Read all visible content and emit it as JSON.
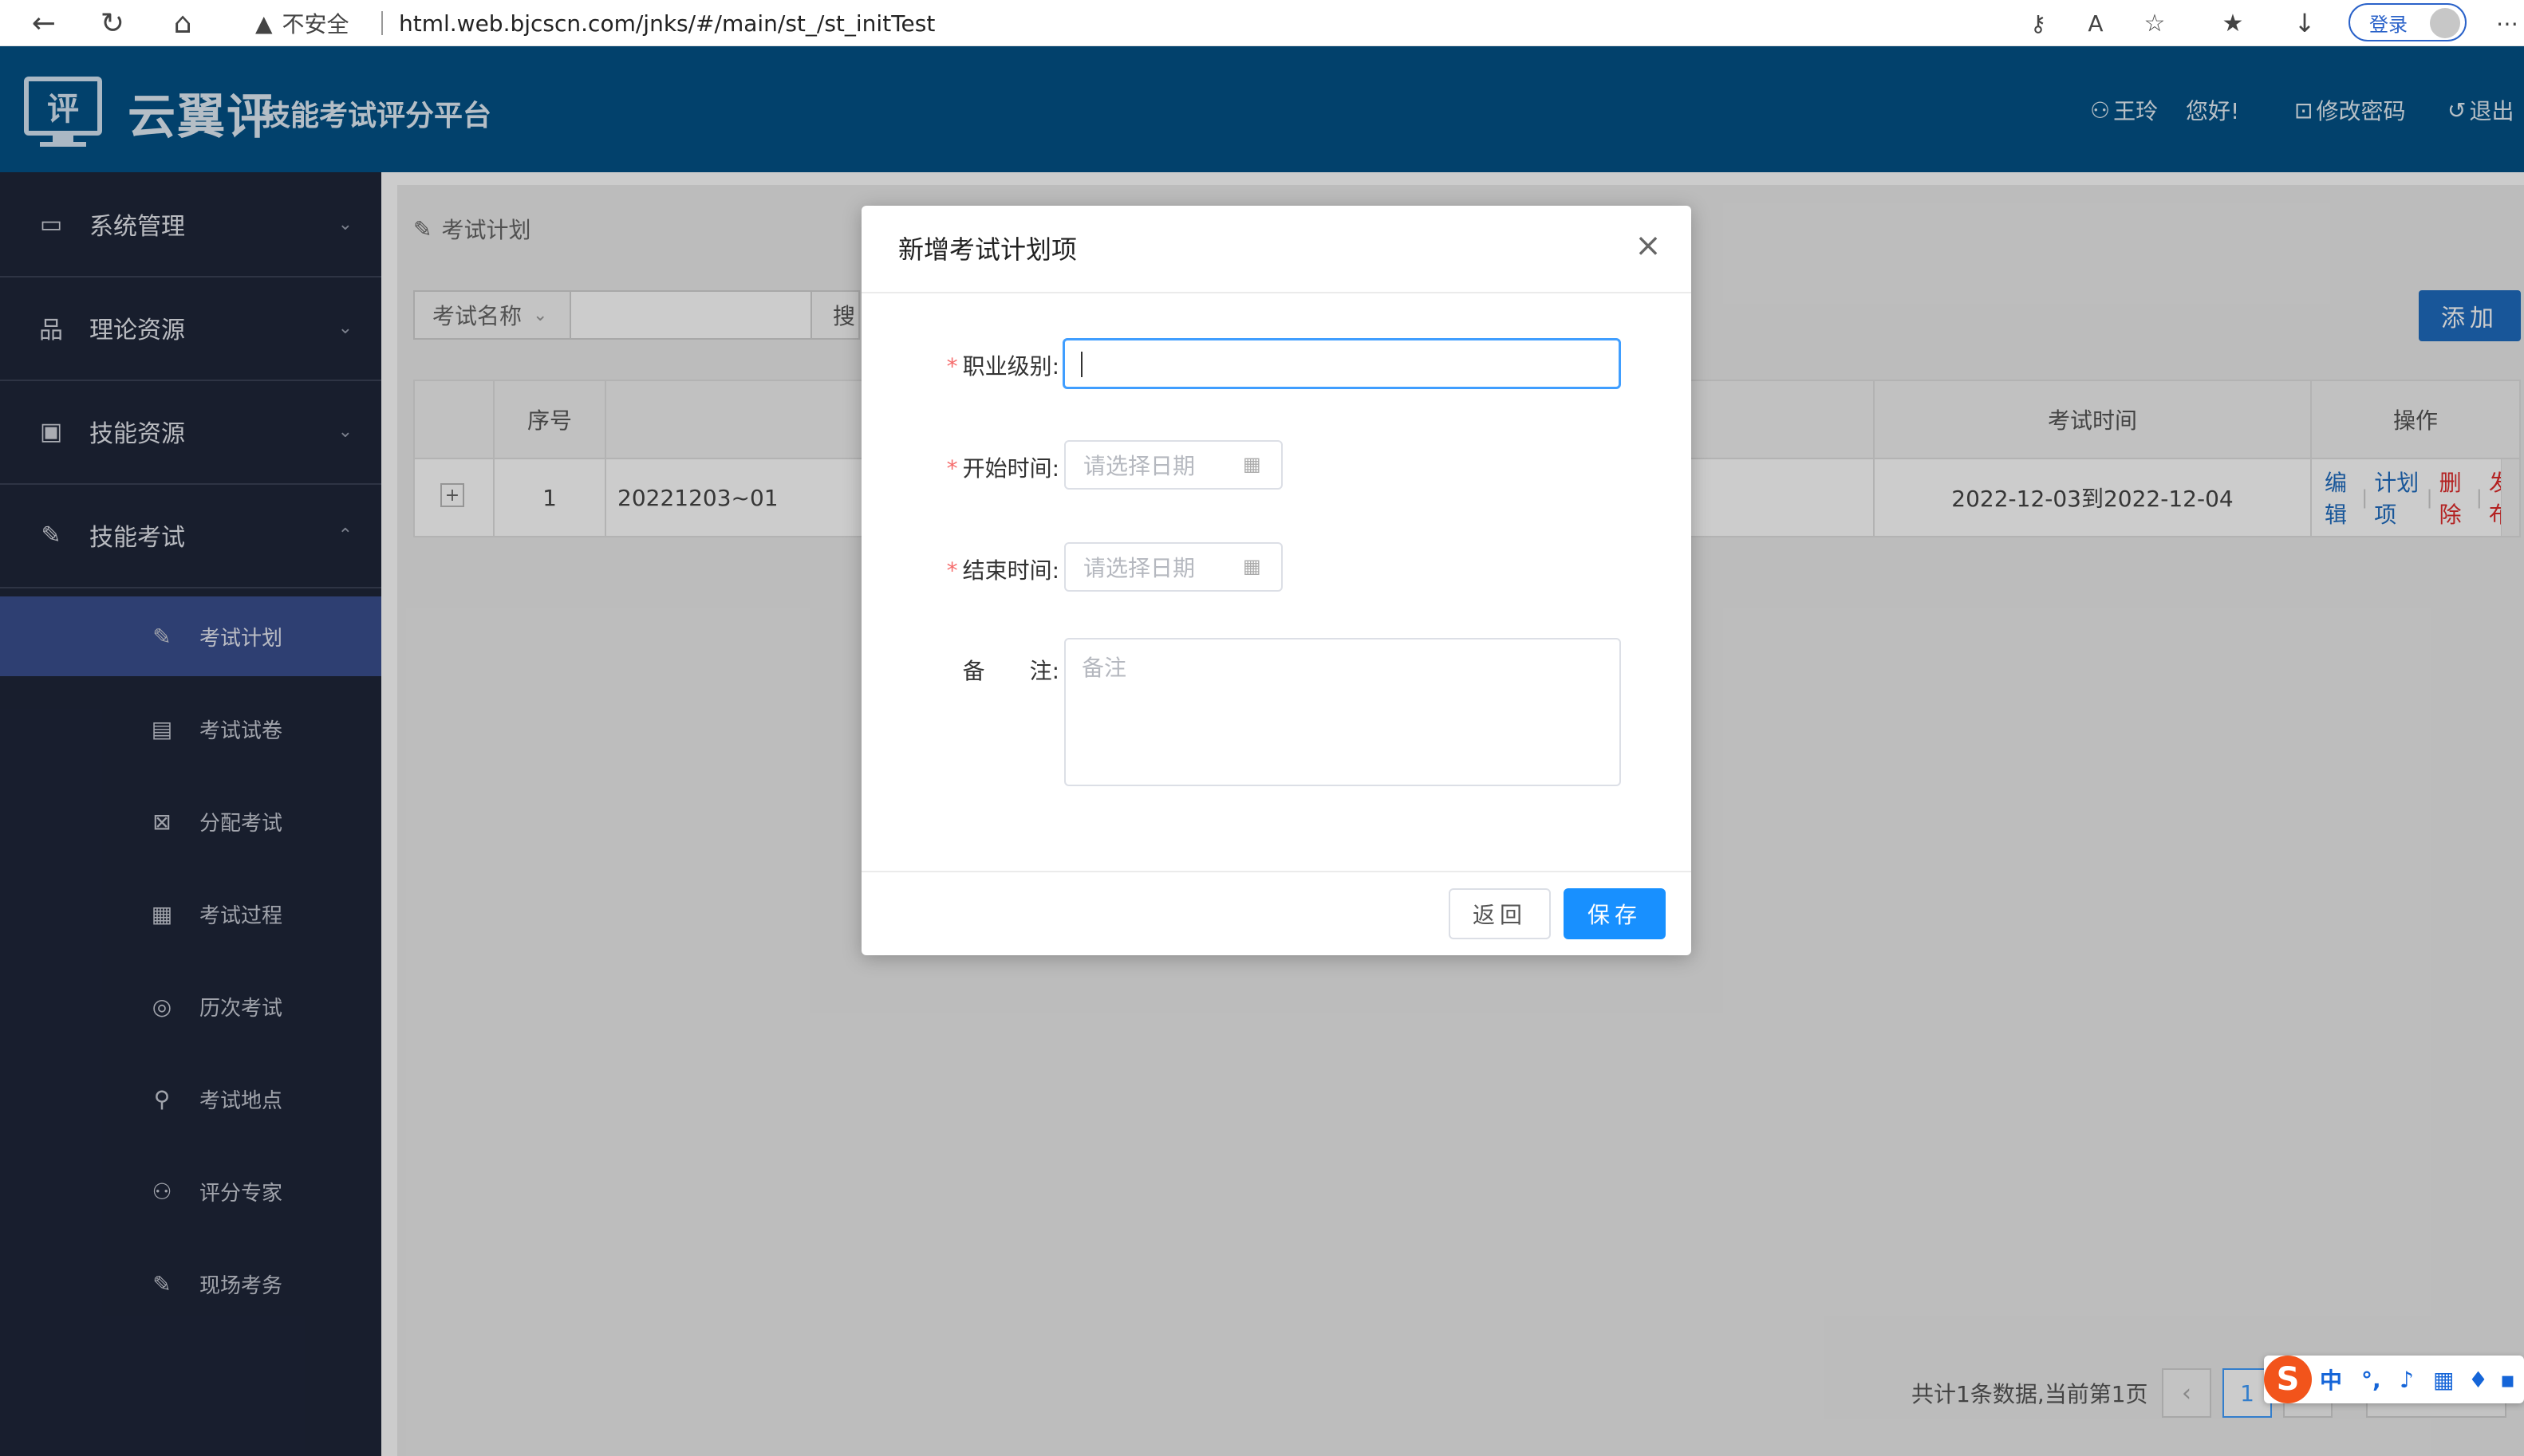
{
  "browser": {
    "back_icon": "back-arrow-icon",
    "security_label": "不安全",
    "url": "html.web.bjcscn.com/jnks/#/main/st_/st_initTest",
    "login_label": "登录"
  },
  "header": {
    "app_name": "云翼评",
    "app_subtitle": "技能考试评分平台",
    "logo_char": "评",
    "user_name": "王玲",
    "greeting": "您好!",
    "change_password": "修改密码",
    "logout": "退出"
  },
  "sidebar": {
    "groups": [
      {
        "label": "系统管理",
        "icon": "monitor-icon"
      },
      {
        "label": "理论资源",
        "icon": "hierarchy-icon"
      },
      {
        "label": "技能资源",
        "icon": "screen-icon"
      },
      {
        "label": "技能考试",
        "icon": "edit-doc-icon"
      }
    ],
    "sub_items": [
      {
        "label": "考试计划",
        "icon": "edit-doc-icon"
      },
      {
        "label": "考试试卷",
        "icon": "paper-icon"
      },
      {
        "label": "分配考试",
        "icon": "assign-icon"
      },
      {
        "label": "考试过程",
        "icon": "process-icon"
      },
      {
        "label": "历次考试",
        "icon": "history-icon"
      },
      {
        "label": "考试地点",
        "icon": "location-icon"
      },
      {
        "label": "评分专家",
        "icon": "users-icon"
      },
      {
        "label": "现场考务",
        "icon": "edit-doc-icon"
      }
    ]
  },
  "main": {
    "breadcrumb": "考试计划",
    "search_field": "考试名称",
    "search_button": "搜",
    "add_button": "添加",
    "table": {
      "headers": {
        "index": "序号",
        "time": "考试时间",
        "ops": "操作"
      },
      "rows": [
        {
          "index": "1",
          "name": "20221203~01",
          "time": "2022-12-03到2022-12-04",
          "ops": [
            "编辑",
            "计划项",
            "删除",
            "发布"
          ]
        }
      ]
    },
    "pagination": {
      "info": "共计1条数据,当前第1页",
      "current_page": "1"
    }
  },
  "dialog": {
    "title": "新增考试计划项",
    "fields": {
      "level_label": "职业级别:",
      "start_label": "开始时间:",
      "end_label": "结束时间:",
      "remark_label": "备　　注:",
      "date_placeholder": "请选择日期",
      "remark_placeholder": "备注"
    },
    "back_button": "返回",
    "save_button": "保存"
  },
  "ime": {
    "logo": "S",
    "mode": "中"
  },
  "colors": {
    "header_bg": "#035287",
    "sidebar_bg": "#1e2639",
    "active_item": "#3a4f8f",
    "primary": "#1890ff",
    "link_blue": "#1f6cc0",
    "danger": "#e02b2b"
  }
}
